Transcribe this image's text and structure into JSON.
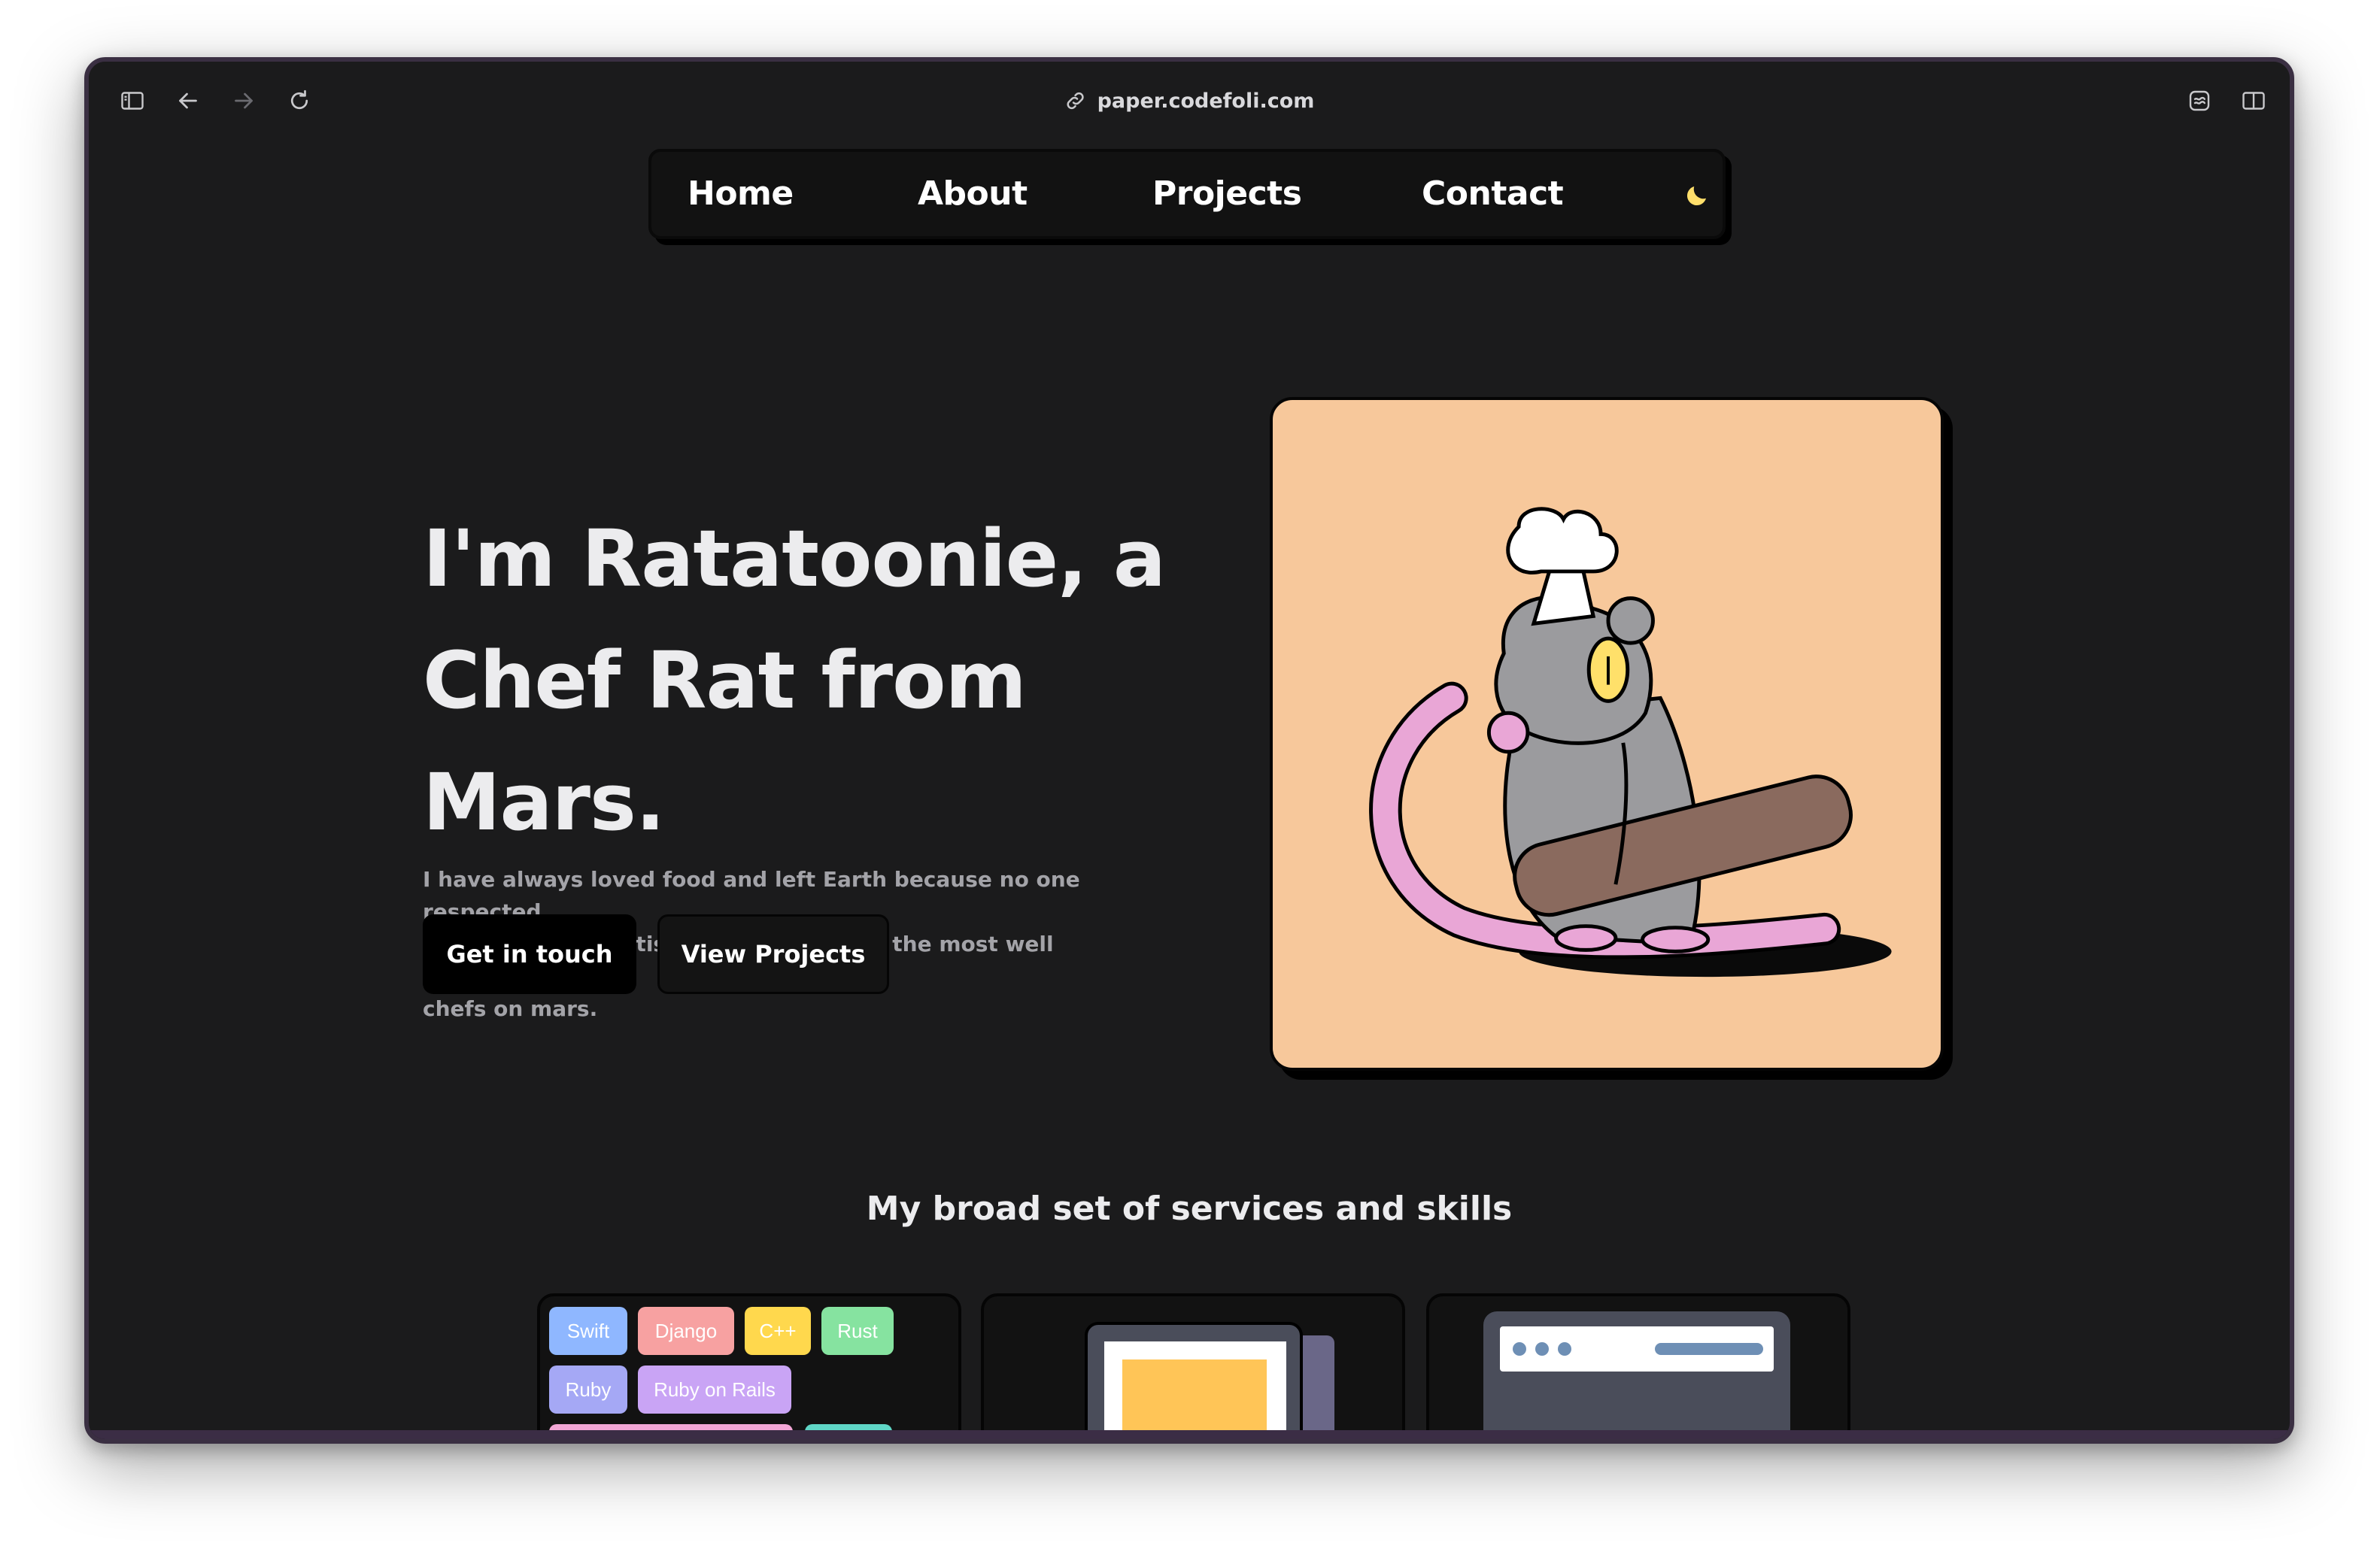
{
  "browser": {
    "url": "paper.codefoli.com",
    "icons": [
      "sidebar-icon",
      "back-icon",
      "forward-icon",
      "reload-icon",
      "link-icon",
      "extensions-icon",
      "split-view-icon"
    ]
  },
  "nav": {
    "items": [
      {
        "label": "Home"
      },
      {
        "label": "About"
      },
      {
        "label": "Projects"
      },
      {
        "label": "Contact"
      }
    ],
    "theme_icon": "moon-icon"
  },
  "hero": {
    "title_line1": "I'm Ratatoonie, a",
    "title_line2": "Chef Rat from",
    "title_line3": "Mars.",
    "description_line1": "I have always loved food and left Earth because no one respected",
    "description_line2": "my culinary expertise. I am now one of the most well respected",
    "description_line3": "chefs on mars.",
    "primary_button": "Get in touch",
    "secondary_button": "View Projects",
    "image_background": "#f7c89b"
  },
  "services": {
    "title": "My broad set of services and skills",
    "skills": [
      {
        "label": "Swift",
        "color": "#8fb7ff"
      },
      {
        "label": "Django",
        "color": "#f7a1a1"
      },
      {
        "label": "C++",
        "color": "#ffd84d"
      },
      {
        "label": "Rust",
        "color": "#86e3a0"
      },
      {
        "label": "Ruby",
        "color": "#a5a8f5"
      },
      {
        "label": "Ruby on Rails",
        "color": "#c9a4f5"
      }
    ]
  },
  "colors": {
    "page_bg": "#1b1b1c",
    "accent_yellow": "#ffdf6b"
  }
}
